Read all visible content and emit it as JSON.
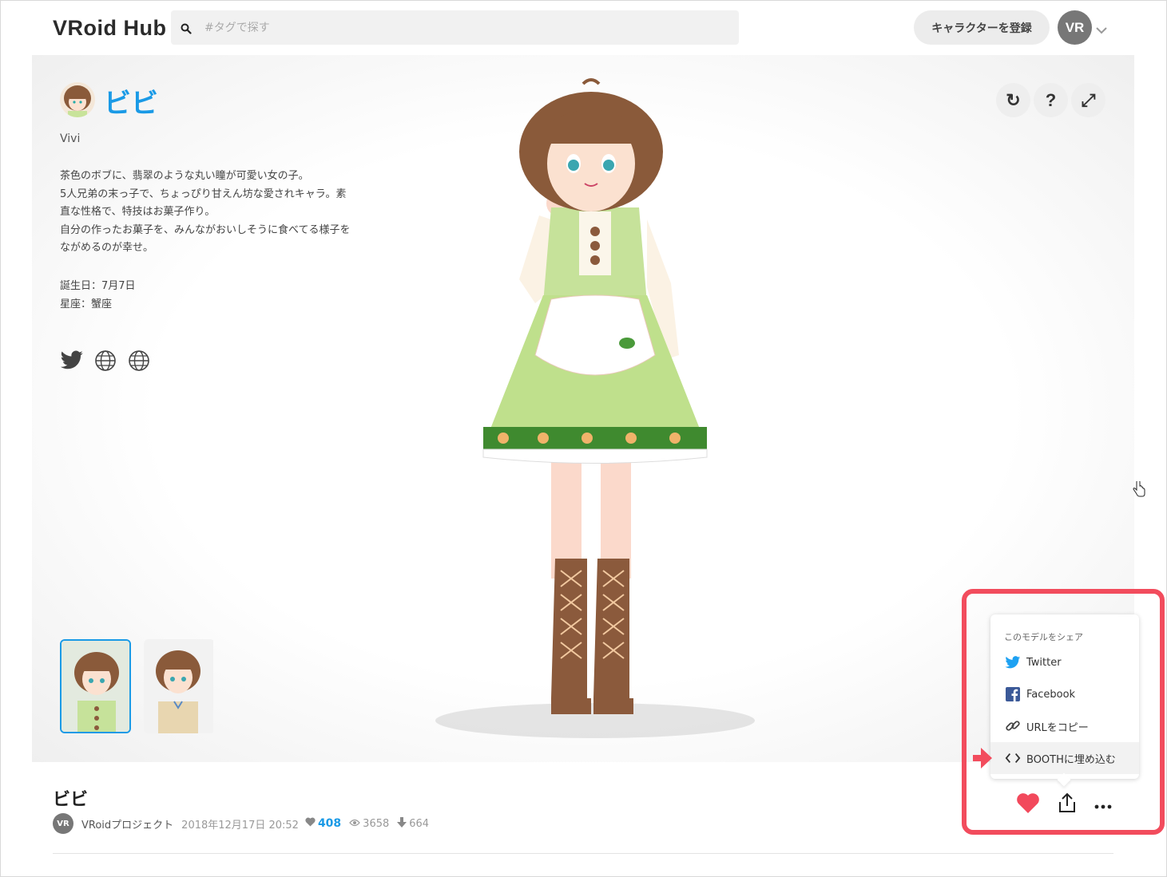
{
  "header": {
    "logo": "VRoid Hub",
    "search_placeholder": "#タグで探す",
    "register_label": "キャラクターを登録",
    "avatar_label": "VR"
  },
  "character": {
    "name": "ビビ",
    "subtitle": "Vivi",
    "description": [
      "茶色のボブに、翡翠のような丸い瞳が可愛い女の子。",
      "5人兄弟の末っ子で、ちょっぴり甘えん坊な愛されキャラ。素",
      "直な性格で、特技はお菓子作り。",
      "自分の作ったお菓子を、みんながおいしそうに食べてる様子を",
      "ながめるのが幸せ。"
    ],
    "birthday": "誕生日：7月7日",
    "zodiac": "星座：蟹座"
  },
  "viewer_tools": {
    "reset": "↻",
    "help": "?",
    "fullscreen": "⤢"
  },
  "model_info": {
    "title": "ビビ",
    "author_avatar": "VR",
    "author": "VRoidプロジェクト",
    "date": "2018年12月17日 20:52",
    "likes": "408",
    "views": "3658",
    "downloads": "664"
  },
  "share_menu": {
    "header": "このモデルをシェア",
    "items": [
      {
        "label": "Twitter",
        "icon": "twitter-icon"
      },
      {
        "label": "Facebook",
        "icon": "facebook-icon"
      },
      {
        "label": "URLをコピー",
        "icon": "link-icon"
      },
      {
        "label": "BOOTHに埋め込む",
        "icon": "code-icon"
      }
    ]
  },
  "colors": {
    "accent": "#1a9ae6",
    "highlight": "#f24c5d",
    "heart": "#f2495c"
  }
}
